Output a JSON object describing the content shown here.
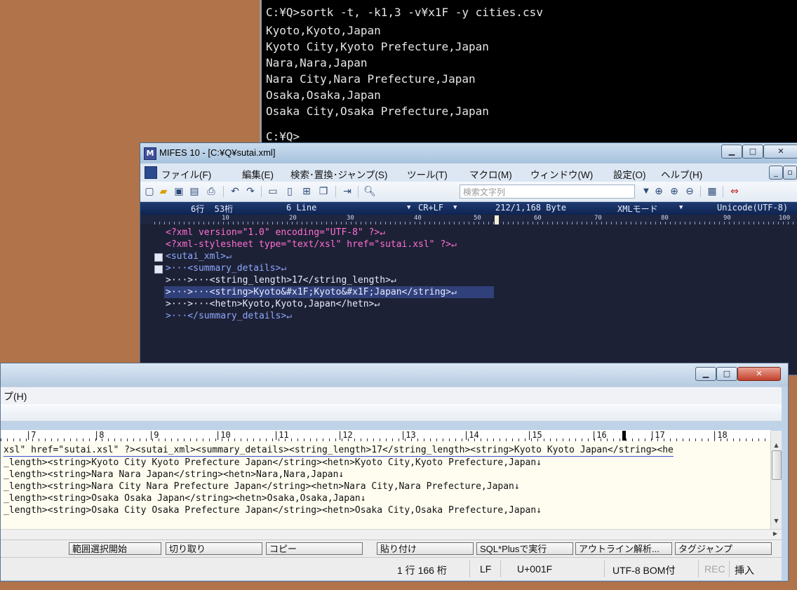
{
  "console": {
    "lines": [
      "C:¥Q>sortk -t, -k1,3 -v¥x1F -y cities.csv",
      "Kyoto,Kyoto,Japan",
      "Kyoto City,Kyoto Prefecture,Japan",
      "Nara,Nara,Japan",
      "Nara City,Nara Prefecture,Japan",
      "Osaka,Osaka,Japan",
      "Osaka City,Osaka Prefecture,Japan",
      "",
      "C:¥Q>"
    ]
  },
  "mifes": {
    "title": "MIFES 10 - [C:¥Q¥sutai.xml]",
    "icon_letter": "M",
    "menu": [
      "ファイル(F)",
      "編集(E)",
      "検索･置換･ジャンプ(S)",
      "ツール(T)",
      "マクロ(M)",
      "ウィンドウ(W)",
      "設定(O)",
      "ヘルプ(H)"
    ],
    "search_placeholder": "検索文字列",
    "status": {
      "position": "6行  53桁",
      "lines": "6 Line",
      "eol": "CR+LF",
      "size": "212/1,168 Byte",
      "mode": "XMLモード",
      "encoding": "Unicode(UTF-8)"
    },
    "ruler": [
      "10",
      "20",
      "30",
      "40",
      "50",
      "60",
      "70",
      "80",
      "90",
      "100"
    ],
    "lines": [
      "<?xml version=\"1.0\" encoding=\"UTF-8\" ?>↵",
      "<?xml-stylesheet type=\"text/xsl\" href=\"sutai.xsl\" ?>↵",
      "<sutai_xml>↵",
      ">···<summary_details>↵",
      ">···>···<string_length>17</string_length>↵",
      ">···>···<string>Kyoto&#x1F;Kyoto&#x1F;Japan</string>↵",
      ">···>···<hetn>Kyoto,Kyoto,Japan</hetn>↵",
      ">···</summary_details>↵"
    ]
  },
  "editor": {
    "menu_label": "プ(H)",
    "ruler": [
      "|7",
      "|8",
      "|9",
      "|10",
      "|11",
      "|12",
      "|13",
      "|14",
      "|15",
      "|16",
      "|17",
      "|18"
    ],
    "lines": [
      "xsl\" href=\"sutai.xsl\" ?><sutai_xml><summary_details><string_length>17</string_length><string>Kyoto Kyoto Japan</string><he",
      "_length><string>Kyoto City Kyoto Prefecture Japan</string><hetn>Kyoto City,Kyoto Prefecture,Japan↓",
      "_length><string>Nara Nara Japan</string><hetn>Nara,Nara,Japan↓",
      "_length><string>Nara City Nara Prefecture Japan</string><hetn>Nara City,Nara Prefecture,Japan↓",
      "_length><string>Osaka Osaka Japan</string><hetn>Osaka,Osaka,Japan↓",
      "_length><string>Osaka City Osaka Prefecture Japan</string><hetn>Osaka City,Osaka Prefecture,Japan↓"
    ],
    "function_keys": [
      "範囲選択開始",
      "切り取り",
      "コピー",
      "貼り付け",
      "SQL*Plusで実行",
      "アウトライン解析...",
      "タグジャンプ"
    ],
    "statusbar": {
      "position": "1 行  166 桁",
      "eol": "LF",
      "char": "U+001F",
      "encoding": "UTF-8 BOM付",
      "rec": "REC",
      "insert": "挿入"
    }
  },
  "colors": {
    "desktop": "#b0734a",
    "console_bg": "#000000",
    "xml_string": "#ff6fd2",
    "xml_tag": "#8fa8ff",
    "xml_text": "#ffffff",
    "fg_edit_bg": "#fffdf0"
  }
}
